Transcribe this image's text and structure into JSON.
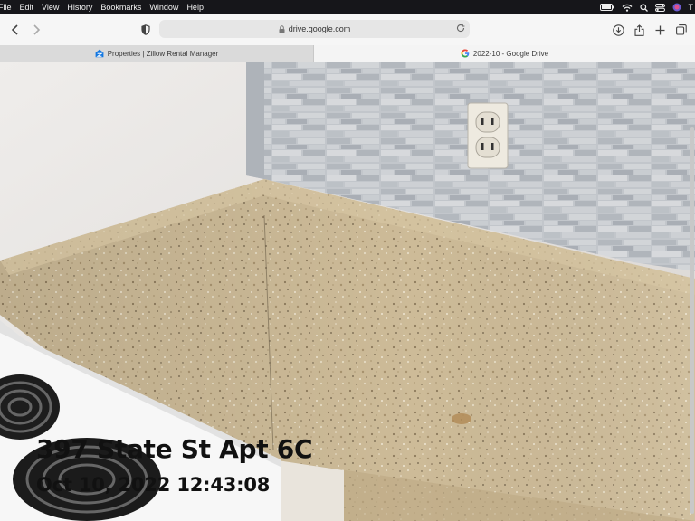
{
  "menubar": {
    "items": [
      "File",
      "Edit",
      "View",
      "History",
      "Bookmarks",
      "Window",
      "Help"
    ],
    "status_icons": [
      "battery-icon",
      "wifi-icon",
      "spotlight-icon",
      "control-center-icon",
      "siri-icon",
      "user-icon"
    ],
    "clock_fragment": "T"
  },
  "toolbar": {
    "address": "drive.google.com",
    "icons": [
      "back-icon",
      "forward-icon",
      "privacy-shield-icon",
      "lock-icon",
      "reload-icon",
      "downloads-icon",
      "share-icon",
      "new-tab-icon",
      "tab-overview-icon"
    ]
  },
  "tabs": [
    {
      "label": "Properties | Zillow Rental Manager",
      "active": false,
      "icon": "zillow-icon"
    },
    {
      "label": "2022-10 - Google Drive",
      "active": true,
      "icon": "google-icon"
    }
  ],
  "photo": {
    "caption_address": "397 State St Apt 6C",
    "caption_timestamp": "Oct 10, 2022 12:43:08"
  },
  "colors": {
    "menubar_bg": "#16161a",
    "toolbar_bg": "#f6f6f6",
    "countertop": "#cdbb98",
    "backsplash": "#b9bdc2",
    "wall": "#e7e4e2"
  }
}
